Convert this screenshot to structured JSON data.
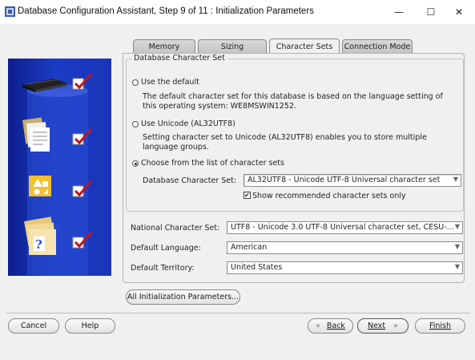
{
  "window": {
    "title": "Database Configuration Assistant, Step 9 of 11 : Initialization Parameters",
    "minimize_icon": "minimize-icon",
    "maximize_icon": "maximize-icon",
    "close_icon": "close-icon"
  },
  "tabs": [
    {
      "label": "Memory"
    },
    {
      "label": "Sizing"
    },
    {
      "label": "Character Sets"
    },
    {
      "label": "Connection Mode"
    }
  ],
  "charset_group": {
    "legend": "Database Character Set",
    "option_default": "Use the default",
    "default_desc": "The default character set for this database is based on the language setting of this operating system: WE8MSWIN1252.",
    "option_unicode": "Use Unicode (AL32UTF8)",
    "unicode_desc": "Setting character set to Unicode (AL32UTF8) enables you to store multiple language groups.",
    "option_list": "Choose from the list of character sets",
    "db_charset_label": "Database Character Set:",
    "db_charset_value": "AL32UTF8 - Unicode UTF-8 Universal character set",
    "show_recommended_label": "Show recommended character sets only",
    "show_recommended_checked": true
  },
  "national_charset": {
    "label": "National Character Set:",
    "value": "UTF8 - Unicode 3.0 UTF-8 Universal character set, CESU-..."
  },
  "default_language": {
    "label": "Default Language:",
    "value": "American"
  },
  "default_territory": {
    "label": "Default Territory:",
    "value": "United States"
  },
  "buttons": {
    "all_params": "All Initialization Parameters...",
    "cancel": "Cancel",
    "help": "Help",
    "back": "Back",
    "next": "Next",
    "finish": "Finish"
  },
  "colors": {
    "accent_blue": "#1a3cc4",
    "check_red": "#c0151b"
  }
}
